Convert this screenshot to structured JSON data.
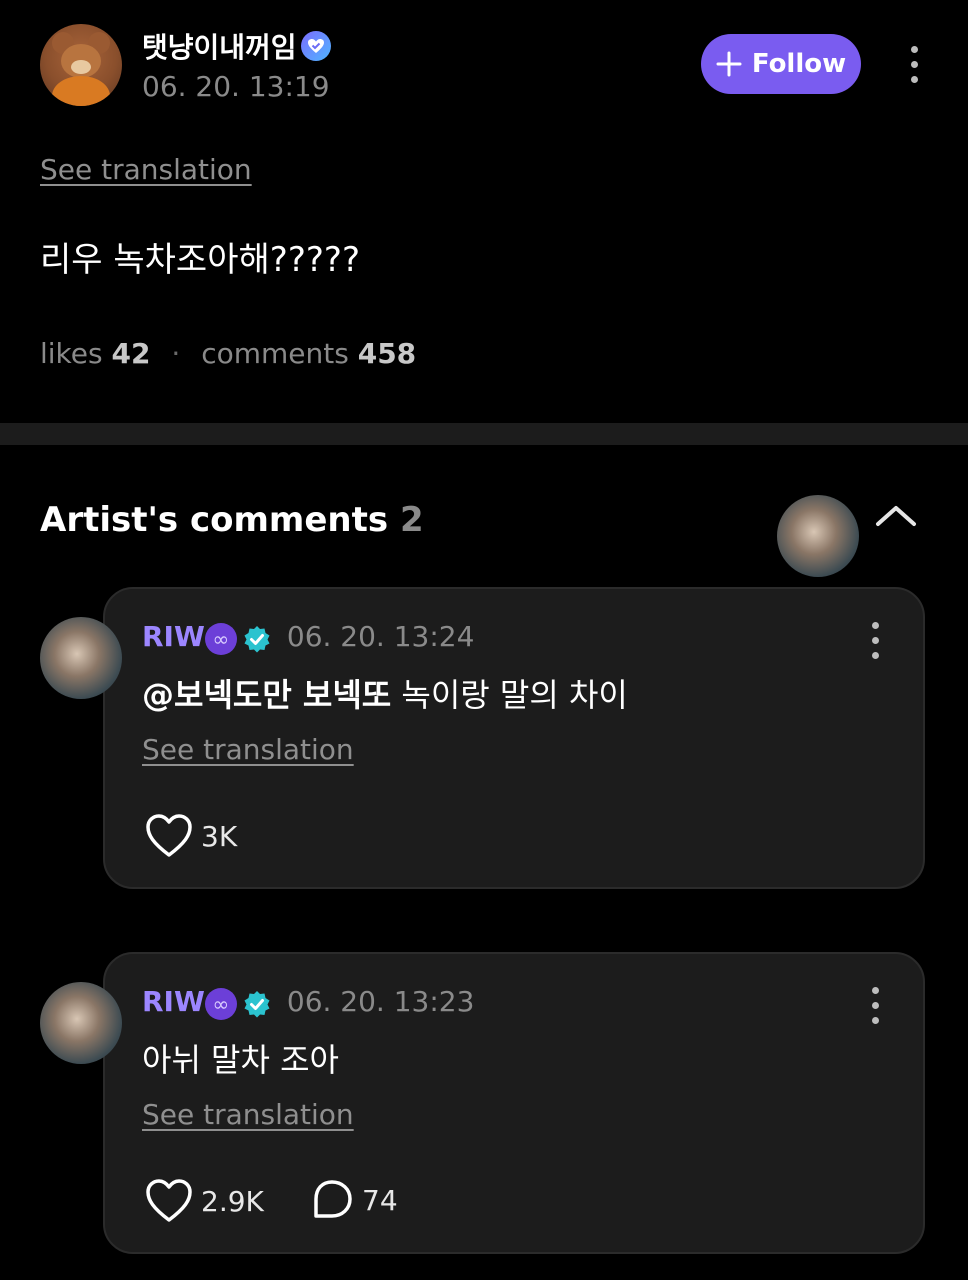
{
  "post": {
    "author": "탯냥이내꺼임",
    "time": "06. 20. 13:19",
    "follow_label": "Follow",
    "see_translation": "See translation",
    "text": "리우 녹차조아해?????",
    "likes_label": "likes",
    "likes_count": "42",
    "separator": "·",
    "comments_label": "comments",
    "comments_count": "458"
  },
  "artist_comments": {
    "title": "Artist's comments",
    "count": "2",
    "items": [
      {
        "name": "RIW",
        "badge": "∞",
        "time": "06. 20. 13:24",
        "mention": "@보넥도만 보넥또",
        "text": " 녹이랑 말의 차이",
        "see_translation": "See translation",
        "likes": "3K"
      },
      {
        "name": "RIW",
        "badge": "∞",
        "time": "06. 20. 13:23",
        "text": "아뉘 말차 조아",
        "see_translation": "See translation",
        "likes": "2.9K",
        "replies": "74"
      }
    ]
  },
  "colors": {
    "accent": "#7a5cf0",
    "artist_name": "#9c86ff",
    "background": "#000000",
    "card": "#1c1c1c"
  }
}
